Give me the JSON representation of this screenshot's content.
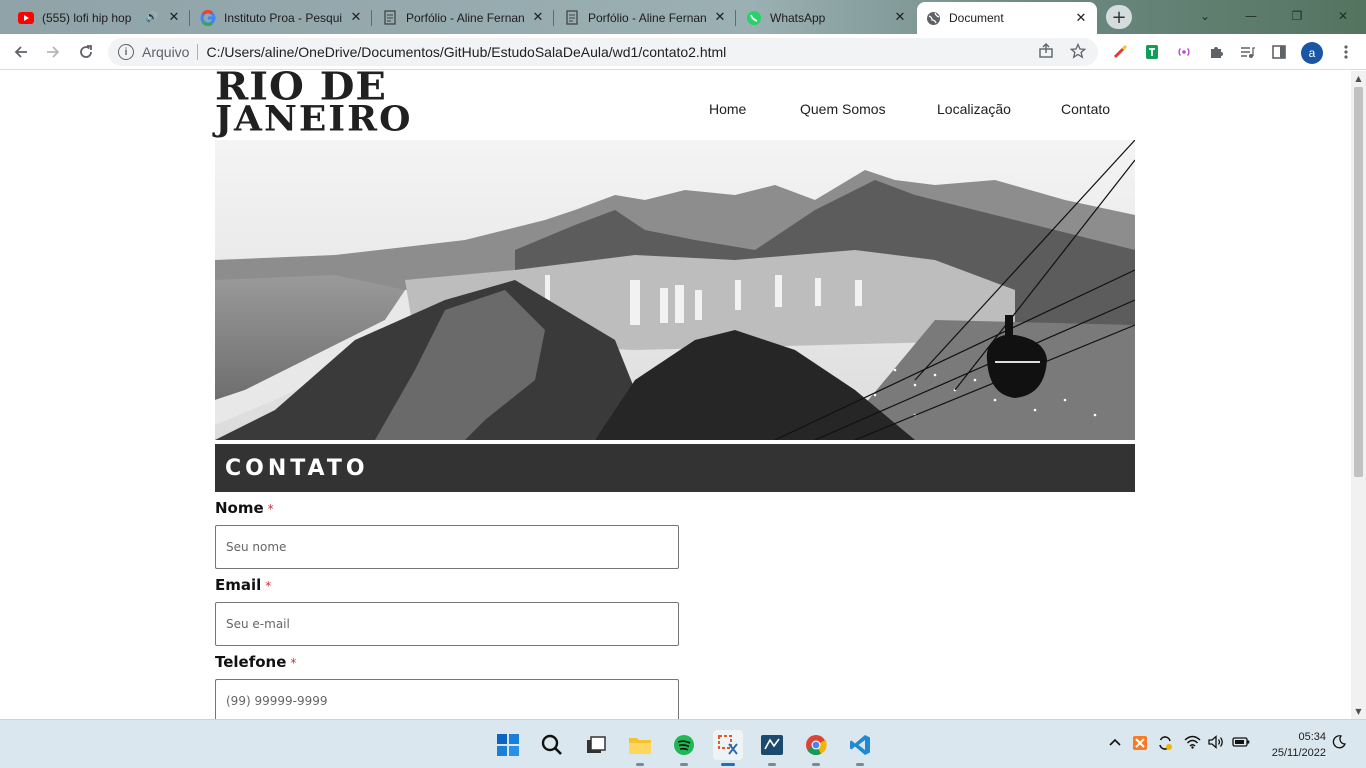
{
  "browser": {
    "tabs": [
      {
        "title": "(555) lofi hip hop",
        "favicon": "youtube-icon",
        "audio": true
      },
      {
        "title": "Instituto Proa - Pesqui",
        "favicon": "google-icon"
      },
      {
        "title": "Porfólio - Aline Fernan",
        "favicon": "document-icon"
      },
      {
        "title": "Porfólio - Aline Fernan",
        "favicon": "document-icon"
      },
      {
        "title": "WhatsApp",
        "favicon": "whatsapp-icon"
      },
      {
        "title": "Document",
        "favicon": "globe-icon",
        "active": true
      }
    ],
    "address": {
      "scheme_label": "Arquivo",
      "url": "C:/Users/aline/OneDrive/Documentos/GitHub/EstudoSalaDeAula/wd1/contato2.html"
    },
    "profile_initial": "a"
  },
  "page": {
    "logo": {
      "line1": "RIO DE",
      "line2": "JANEIRO"
    },
    "nav": [
      "Home",
      "Quem Somos",
      "Localização",
      "Contato"
    ],
    "section_title": "CONTATO",
    "form": {
      "fields": [
        {
          "label": "Nome",
          "required_mark": "*",
          "placeholder": "Seu nome"
        },
        {
          "label": "Email",
          "required_mark": "*",
          "placeholder": "Seu e-mail"
        },
        {
          "label": "Telefone",
          "required_mark": "*",
          "placeholder": "(99) 99999-9999"
        }
      ]
    }
  },
  "taskbar": {
    "time": "05:34",
    "date": "25/11/2022"
  },
  "colors": {
    "section_bar": "#333333",
    "required": "#cc3333",
    "taskbar": "#dbe7ee"
  }
}
